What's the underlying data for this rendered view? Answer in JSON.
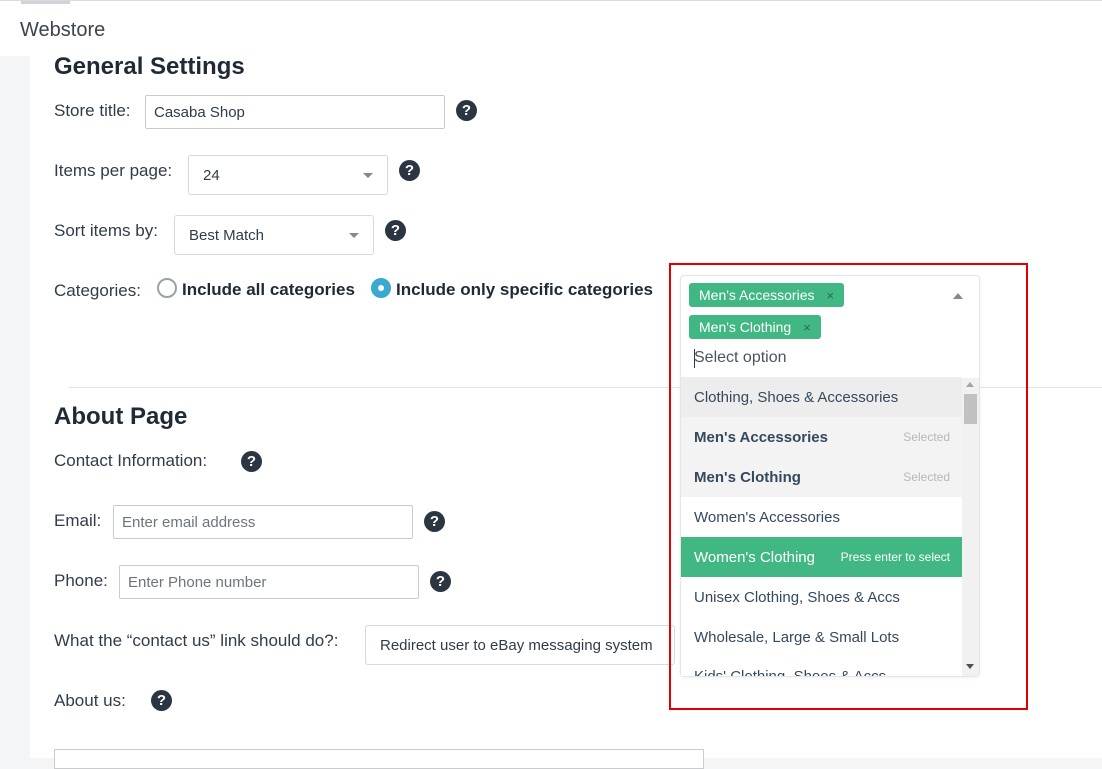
{
  "app": {
    "title": "Webstore"
  },
  "general": {
    "heading": "General Settings",
    "store_title_label": "Store title:",
    "store_title_value": "Casaba Shop",
    "items_per_page_label": "Items per page:",
    "items_per_page_value": "24",
    "sort_label": "Sort items by:",
    "sort_value": "Best Match",
    "categories_label": "Categories:",
    "radio_all_label": "Include all categories",
    "radio_specific_label": "Include only specific categories",
    "radio_selected": "specific"
  },
  "multiselect": {
    "tags": [
      {
        "label": "Men's Accessories",
        "remove": "×"
      },
      {
        "label": "Men's Clothing",
        "remove": "×"
      }
    ],
    "placeholder": "Select option",
    "options": [
      {
        "label": "Clothing, Shoes & Accessories",
        "state": "group",
        "hint": ""
      },
      {
        "label": "Men's Accessories",
        "state": "selected",
        "hint": "Selected"
      },
      {
        "label": "Men's Clothing",
        "state": "selected",
        "hint": "Selected"
      },
      {
        "label": "Women's Accessories",
        "state": "normal",
        "hint": ""
      },
      {
        "label": "Women's Clothing",
        "state": "highlighted",
        "hint": "Press enter to select"
      },
      {
        "label": "Unisex Clothing, Shoes & Accs",
        "state": "normal",
        "hint": ""
      },
      {
        "label": "Wholesale, Large & Small Lots",
        "state": "normal",
        "hint": ""
      },
      {
        "label": "Kids' Clothing, Shoes & Accs",
        "state": "normal",
        "hint": ""
      }
    ]
  },
  "about": {
    "heading": "About Page",
    "contact_label": "Contact Information:",
    "email_label": "Email:",
    "email_placeholder": "Enter email address",
    "phone_label": "Phone:",
    "phone_placeholder": "Enter Phone number",
    "contact_link_label": "What the “contact us” link should do?:",
    "contact_link_value": "Redirect user to eBay messaging system",
    "about_us_label": "About us:"
  },
  "icons": {
    "help": "?"
  },
  "colors": {
    "tag_green": "#41b883",
    "radio_blue": "#3aa9d0",
    "annotation_red": "#e00000"
  }
}
